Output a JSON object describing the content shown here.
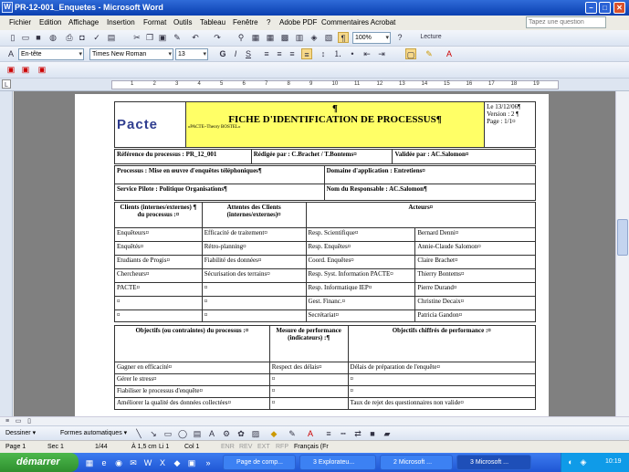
{
  "window": {
    "title": "PR-12-001_Enquetes - Microsoft Word",
    "help_placeholder": "Tapez une question"
  },
  "menu": [
    "Fichier",
    "Edition",
    "Affichage",
    "Insertion",
    "Format",
    "Outils",
    "Tableau",
    "Fenêtre",
    "?",
    "Adobe PDF",
    "Commentaires Acrobat"
  ],
  "toolbar": {
    "zoom": "100%",
    "reading_label": "Lecture",
    "style": "En-tête",
    "font": "Times New Roman",
    "size": "13",
    "bold": "G",
    "italic": "I",
    "underline": "S"
  },
  "ruler_numbers": [
    "1",
    "2",
    "3",
    "4",
    "5",
    "6",
    "7",
    "8",
    "9",
    "10",
    "11",
    "12",
    "13",
    "14",
    "15",
    "16",
    "17",
    "18",
    "19"
  ],
  "doc": {
    "logo": "Pacte",
    "heading_mark": "¶",
    "heading": "FICHE D'IDENTIFICATION DE PROCESSUS¶",
    "style_line": "«PACTE~Theory BOSTEL»",
    "date": "Le 13/12/06¶",
    "version": "Version : 2 ¶",
    "page_no": "Page : 1/1¤",
    "ref": "Référence du processus : PR_12_001",
    "redige": "Rédigée par : C.Brachet / T.Bontems¤",
    "valide": "Validée par : AC.Salomon¤",
    "processus": "Processus : Mise en œuvre d'enquêtes téléphoniques¶",
    "domaine": "Domaine d'application : Entretiens¤",
    "service": "Service Pilote : Politique Organisations¶",
    "responsable": "Nom du Responsable : AC.Salomon¶",
    "col_clients": "Clients (internes/externes) ¶ du processus :¤",
    "col_attentes": "Attentes des Clients (internes/externes)¤",
    "col_acteurs": "Acteurs¤",
    "rows": [
      [
        "Enquêteurs¤",
        "Efficacité de traitement¤",
        "Resp. Scientifique¤",
        "Bernard Denni¤"
      ],
      [
        "Enquêtés¤",
        "Rétro-planning¤",
        "Resp. Enquêtes¤",
        "Annie-Claude Salomon¤"
      ],
      [
        "Etudiants de Progis¤",
        "Fiabilité des données¤",
        "Coord. Enquêtes¤",
        "Claire Brachet¤"
      ],
      [
        "Chercheurs¤",
        "Sécurisation des terrains¤",
        "Resp. Syst. Information PACTE¤",
        "Thierry Bontems¤"
      ],
      [
        "PACTE¤",
        "¤",
        "Resp. Informatique IEP¤",
        "Pierre Durand¤"
      ],
      [
        "¤",
        "¤",
        "Gest. Financ.¤",
        "Christine Decaix¤"
      ],
      [
        "¤",
        "¤",
        "Secrétariat¤",
        "Patricia Gandon¤"
      ]
    ],
    "col_objectifs": "Objectifs (ou contraintes) du processus :¤",
    "col_mesure": "Mesure de performance (indicateurs) :¶",
    "col_chiffres": "Objectifs chiffrés de performance :¤",
    "obj_rows": [
      [
        "Gagner en efficacité¤",
        "Respect des délais¤",
        "Délais de préparation de l'enquête¤"
      ],
      [
        "Gérer le stress¤",
        "¤",
        "¤"
      ],
      [
        "Fiabiliser le processus d'enquête¤",
        "¤",
        "¤"
      ],
      [
        "Améliorer la qualité des données collectées¤",
        "¤",
        "Taux de rejet des questionnaires non valide¤"
      ]
    ]
  },
  "drawbar": {
    "dessiner": "Dessiner ▾",
    "formes": "Formes automatiques ▾"
  },
  "status": {
    "page": "Page 1",
    "sec": "Sec 1",
    "pages": "1/44",
    "at": "À 1,5 cm",
    "li": "Li 1",
    "col": "Col 1",
    "enr": "ENR",
    "rev": "REV",
    "ext": "EXT",
    "rfp": "RFP",
    "lang": "Français (Fr"
  },
  "taskbar": {
    "start": "démarrer",
    "tasks": [
      "Page de comp...",
      "3 Explorateu...",
      "2 Microsoft ...",
      "3 Microsoft ..."
    ],
    "clock": "10:19"
  }
}
